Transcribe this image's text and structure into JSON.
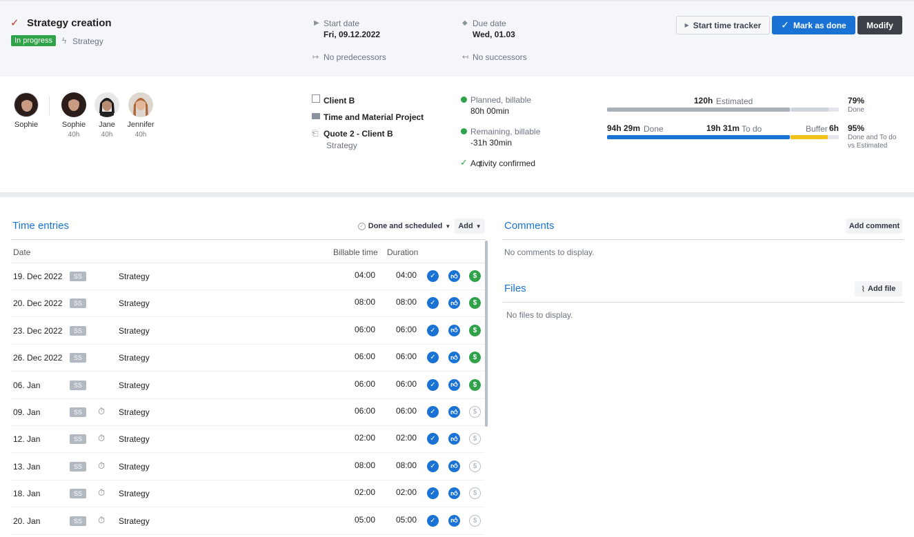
{
  "header": {
    "title": "Strategy creation",
    "status_badge": "In progress",
    "category": "Strategy",
    "start_date_label": "Start date",
    "start_date": "Fri, 09.12.2022",
    "due_date_label": "Due date",
    "due_date": "Wed, 01.03",
    "predecessors": "No predecessors",
    "successors": "No successors",
    "buttons": {
      "time_tracker": "Start time tracker",
      "mark_done": "Mark as done",
      "modify": "Modify"
    }
  },
  "team": {
    "owner": {
      "name": "Sophie"
    },
    "members": [
      {
        "name": "Sophie",
        "hours": "40h"
      },
      {
        "name": "Jane",
        "hours": "40h"
      },
      {
        "name": "Jennifer",
        "hours": "40h"
      }
    ]
  },
  "project": {
    "client": "Client B",
    "project_name": "Time and Material Project",
    "quote": "Quote 2 - Client B",
    "quote_sub": "Strategy"
  },
  "billing": {
    "planned_label": "Planned, billable",
    "planned_value": "80h 00min",
    "remaining_label": "Remaining, billable",
    "remaining_value": "-31h 30min",
    "activity": "Activity confirmed"
  },
  "progress": {
    "estimated_value": "120h",
    "estimated_label": "Estimated",
    "done_pct": "79%",
    "done_pct_label": "Done",
    "done_value": "94h 29m",
    "done_label": "Done",
    "todo_value": "19h 31m",
    "todo_label": "To do",
    "buffer_label": "Buffer",
    "buffer_value": "6h",
    "total_pct": "95%",
    "total_pct_label_1": "Done and To do",
    "total_pct_label_2": "vs Estimated",
    "estimated_fill": 0.79,
    "done_fill": 0.79,
    "todo_fill": 0.16,
    "colors": {
      "done": "#1a73d4",
      "buffer": "#f2c21b",
      "estimated": "#a9b0b9"
    }
  },
  "time_entries": {
    "title": "Time entries",
    "filter": "Done and scheduled",
    "add": "Add",
    "col_date": "Date",
    "col_billable": "Billable time",
    "col_duration": "Duration",
    "rows": [
      {
        "date": "19. Dec 2022",
        "user": "SS",
        "timer": false,
        "activity": "Strategy",
        "billable": "04:00",
        "duration": "04:00",
        "billed": true
      },
      {
        "date": "20. Dec 2022",
        "user": "SS",
        "timer": false,
        "activity": "Strategy",
        "billable": "08:00",
        "duration": "08:00",
        "billed": true
      },
      {
        "date": "23. Dec 2022",
        "user": "SS",
        "timer": false,
        "activity": "Strategy",
        "billable": "06:00",
        "duration": "06:00",
        "billed": true
      },
      {
        "date": "26. Dec 2022",
        "user": "SS",
        "timer": false,
        "activity": "Strategy",
        "billable": "06:00",
        "duration": "06:00",
        "billed": true
      },
      {
        "date": "06. Jan",
        "user": "SS",
        "timer": false,
        "activity": "Strategy",
        "billable": "06:00",
        "duration": "06:00",
        "billed": true
      },
      {
        "date": "09. Jan",
        "user": "SS",
        "timer": true,
        "activity": "Strategy",
        "billable": "06:00",
        "duration": "06:00",
        "billed": false
      },
      {
        "date": "12. Jan",
        "user": "SS",
        "timer": true,
        "activity": "Strategy",
        "billable": "02:00",
        "duration": "02:00",
        "billed": false
      },
      {
        "date": "13. Jan",
        "user": "SS",
        "timer": true,
        "activity": "Strategy",
        "billable": "08:00",
        "duration": "08:00",
        "billed": false
      },
      {
        "date": "18. Jan",
        "user": "SS",
        "timer": true,
        "activity": "Strategy",
        "billable": "02:00",
        "duration": "02:00",
        "billed": false
      },
      {
        "date": "20. Jan",
        "user": "SS",
        "timer": true,
        "activity": "Strategy",
        "billable": "05:00",
        "duration": "05:00",
        "billed": false
      }
    ]
  },
  "comments": {
    "title": "Comments",
    "add": "Add comment",
    "empty": "No comments to display."
  },
  "files": {
    "title": "Files",
    "add": "Add file",
    "empty": "No files to display."
  }
}
